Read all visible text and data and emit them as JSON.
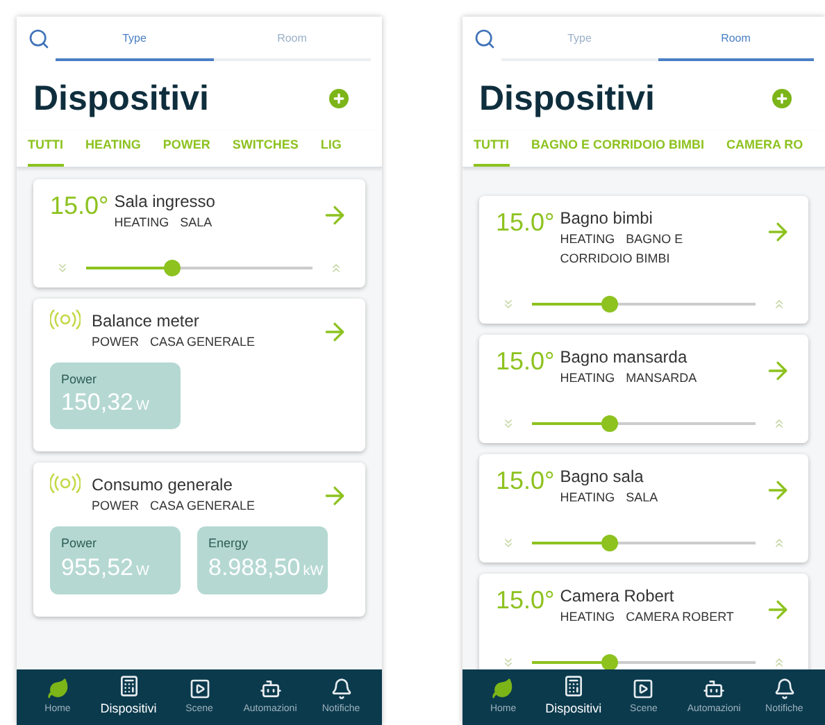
{
  "screens": [
    {
      "tabs": [
        {
          "label": "Type",
          "selected": true
        },
        {
          "label": "Room",
          "selected": false
        }
      ],
      "title": "Dispositivi",
      "filters": [
        {
          "label": "TUTTI",
          "selected": true
        },
        {
          "label": "HEATING",
          "selected": false
        },
        {
          "label": "POWER",
          "selected": false
        },
        {
          "label": "SWITCHES",
          "selected": false
        },
        {
          "label": "LIG",
          "selected": false
        }
      ],
      "devices": [
        {
          "kind": "thermostat",
          "temperature": "15.0°",
          "name": "Sala ingresso",
          "tags": [
            "HEATING",
            "SALA"
          ],
          "level": 0.38
        },
        {
          "kind": "meter",
          "name": "Balance meter",
          "tags": [
            "POWER",
            "CASA GENERALE"
          ],
          "readings": [
            {
              "label": "Power",
              "value": "150,32",
              "unit": "W"
            }
          ]
        },
        {
          "kind": "meter",
          "name": "Consumo generale",
          "tags": [
            "POWER",
            "CASA GENERALE"
          ],
          "readings": [
            {
              "label": "Power",
              "value": "955,52",
              "unit": "W"
            },
            {
              "label": "Energy",
              "value": "8.988,50",
              "unit": "kW"
            }
          ]
        }
      ],
      "nav": [
        {
          "label": "Home",
          "selected": false
        },
        {
          "label": "Dispositivi",
          "selected": true
        },
        {
          "label": "Scene",
          "selected": false
        },
        {
          "label": "Automazioni",
          "selected": false
        },
        {
          "label": "Notifiche",
          "selected": false
        }
      ]
    },
    {
      "tabs": [
        {
          "label": "Type",
          "selected": false
        },
        {
          "label": "Room",
          "selected": true
        }
      ],
      "title": "Dispositivi",
      "filters": [
        {
          "label": "TUTTI",
          "selected": true
        },
        {
          "label": "BAGNO E CORRIDOIO BIMBI",
          "selected": false
        },
        {
          "label": "CAMERA RO",
          "selected": false
        }
      ],
      "devices": [
        {
          "kind": "thermostat",
          "temperature": "15.0°",
          "name": "Bagno bimbi",
          "tags": [
            "HEATING",
            "BAGNO E CORRIDOIO BIMBI"
          ],
          "level": 0.35
        },
        {
          "kind": "thermostat",
          "temperature": "15.0°",
          "name": "Bagno mansarda",
          "tags": [
            "HEATING",
            "MANSARDA"
          ],
          "level": 0.35
        },
        {
          "kind": "thermostat",
          "temperature": "15.0°",
          "name": "Bagno sala",
          "tags": [
            "HEATING",
            "SALA"
          ],
          "level": 0.35
        },
        {
          "kind": "thermostat",
          "temperature": "15.0°",
          "name": "Camera Robert",
          "tags": [
            "HEATING",
            "CAMERA ROBERT"
          ],
          "level": 0.35
        }
      ],
      "nav": [
        {
          "label": "Home",
          "selected": false
        },
        {
          "label": "Dispositivi",
          "selected": true
        },
        {
          "label": "Scene",
          "selected": false
        },
        {
          "label": "Automazioni",
          "selected": false
        },
        {
          "label": "Notifiche",
          "selected": false
        }
      ]
    }
  ]
}
